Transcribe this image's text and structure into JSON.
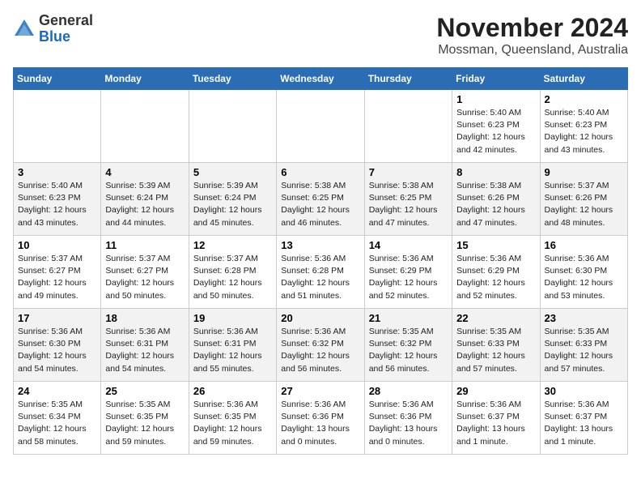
{
  "header": {
    "logo": {
      "general": "General",
      "blue": "Blue"
    },
    "title": "November 2024",
    "location": "Mossman, Queensland, Australia"
  },
  "weekdays": [
    "Sunday",
    "Monday",
    "Tuesday",
    "Wednesday",
    "Thursday",
    "Friday",
    "Saturday"
  ],
  "weeks": [
    [
      {
        "day": "",
        "info": ""
      },
      {
        "day": "",
        "info": ""
      },
      {
        "day": "",
        "info": ""
      },
      {
        "day": "",
        "info": ""
      },
      {
        "day": "",
        "info": ""
      },
      {
        "day": "1",
        "info": "Sunrise: 5:40 AM\nSunset: 6:23 PM\nDaylight: 12 hours\nand 42 minutes."
      },
      {
        "day": "2",
        "info": "Sunrise: 5:40 AM\nSunset: 6:23 PM\nDaylight: 12 hours\nand 43 minutes."
      }
    ],
    [
      {
        "day": "3",
        "info": "Sunrise: 5:40 AM\nSunset: 6:23 PM\nDaylight: 12 hours\nand 43 minutes."
      },
      {
        "day": "4",
        "info": "Sunrise: 5:39 AM\nSunset: 6:24 PM\nDaylight: 12 hours\nand 44 minutes."
      },
      {
        "day": "5",
        "info": "Sunrise: 5:39 AM\nSunset: 6:24 PM\nDaylight: 12 hours\nand 45 minutes."
      },
      {
        "day": "6",
        "info": "Sunrise: 5:38 AM\nSunset: 6:25 PM\nDaylight: 12 hours\nand 46 minutes."
      },
      {
        "day": "7",
        "info": "Sunrise: 5:38 AM\nSunset: 6:25 PM\nDaylight: 12 hours\nand 47 minutes."
      },
      {
        "day": "8",
        "info": "Sunrise: 5:38 AM\nSunset: 6:26 PM\nDaylight: 12 hours\nand 47 minutes."
      },
      {
        "day": "9",
        "info": "Sunrise: 5:37 AM\nSunset: 6:26 PM\nDaylight: 12 hours\nand 48 minutes."
      }
    ],
    [
      {
        "day": "10",
        "info": "Sunrise: 5:37 AM\nSunset: 6:27 PM\nDaylight: 12 hours\nand 49 minutes."
      },
      {
        "day": "11",
        "info": "Sunrise: 5:37 AM\nSunset: 6:27 PM\nDaylight: 12 hours\nand 50 minutes."
      },
      {
        "day": "12",
        "info": "Sunrise: 5:37 AM\nSunset: 6:28 PM\nDaylight: 12 hours\nand 50 minutes."
      },
      {
        "day": "13",
        "info": "Sunrise: 5:36 AM\nSunset: 6:28 PM\nDaylight: 12 hours\nand 51 minutes."
      },
      {
        "day": "14",
        "info": "Sunrise: 5:36 AM\nSunset: 6:29 PM\nDaylight: 12 hours\nand 52 minutes."
      },
      {
        "day": "15",
        "info": "Sunrise: 5:36 AM\nSunset: 6:29 PM\nDaylight: 12 hours\nand 52 minutes."
      },
      {
        "day": "16",
        "info": "Sunrise: 5:36 AM\nSunset: 6:30 PM\nDaylight: 12 hours\nand 53 minutes."
      }
    ],
    [
      {
        "day": "17",
        "info": "Sunrise: 5:36 AM\nSunset: 6:30 PM\nDaylight: 12 hours\nand 54 minutes."
      },
      {
        "day": "18",
        "info": "Sunrise: 5:36 AM\nSunset: 6:31 PM\nDaylight: 12 hours\nand 54 minutes."
      },
      {
        "day": "19",
        "info": "Sunrise: 5:36 AM\nSunset: 6:31 PM\nDaylight: 12 hours\nand 55 minutes."
      },
      {
        "day": "20",
        "info": "Sunrise: 5:36 AM\nSunset: 6:32 PM\nDaylight: 12 hours\nand 56 minutes."
      },
      {
        "day": "21",
        "info": "Sunrise: 5:35 AM\nSunset: 6:32 PM\nDaylight: 12 hours\nand 56 minutes."
      },
      {
        "day": "22",
        "info": "Sunrise: 5:35 AM\nSunset: 6:33 PM\nDaylight: 12 hours\nand 57 minutes."
      },
      {
        "day": "23",
        "info": "Sunrise: 5:35 AM\nSunset: 6:33 PM\nDaylight: 12 hours\nand 57 minutes."
      }
    ],
    [
      {
        "day": "24",
        "info": "Sunrise: 5:35 AM\nSunset: 6:34 PM\nDaylight: 12 hours\nand 58 minutes."
      },
      {
        "day": "25",
        "info": "Sunrise: 5:35 AM\nSunset: 6:35 PM\nDaylight: 12 hours\nand 59 minutes."
      },
      {
        "day": "26",
        "info": "Sunrise: 5:36 AM\nSunset: 6:35 PM\nDaylight: 12 hours\nand 59 minutes."
      },
      {
        "day": "27",
        "info": "Sunrise: 5:36 AM\nSunset: 6:36 PM\nDaylight: 13 hours\nand 0 minutes."
      },
      {
        "day": "28",
        "info": "Sunrise: 5:36 AM\nSunset: 6:36 PM\nDaylight: 13 hours\nand 0 minutes."
      },
      {
        "day": "29",
        "info": "Sunrise: 5:36 AM\nSunset: 6:37 PM\nDaylight: 13 hours\nand 1 minute."
      },
      {
        "day": "30",
        "info": "Sunrise: 5:36 AM\nSunset: 6:37 PM\nDaylight: 13 hours\nand 1 minute."
      }
    ]
  ]
}
